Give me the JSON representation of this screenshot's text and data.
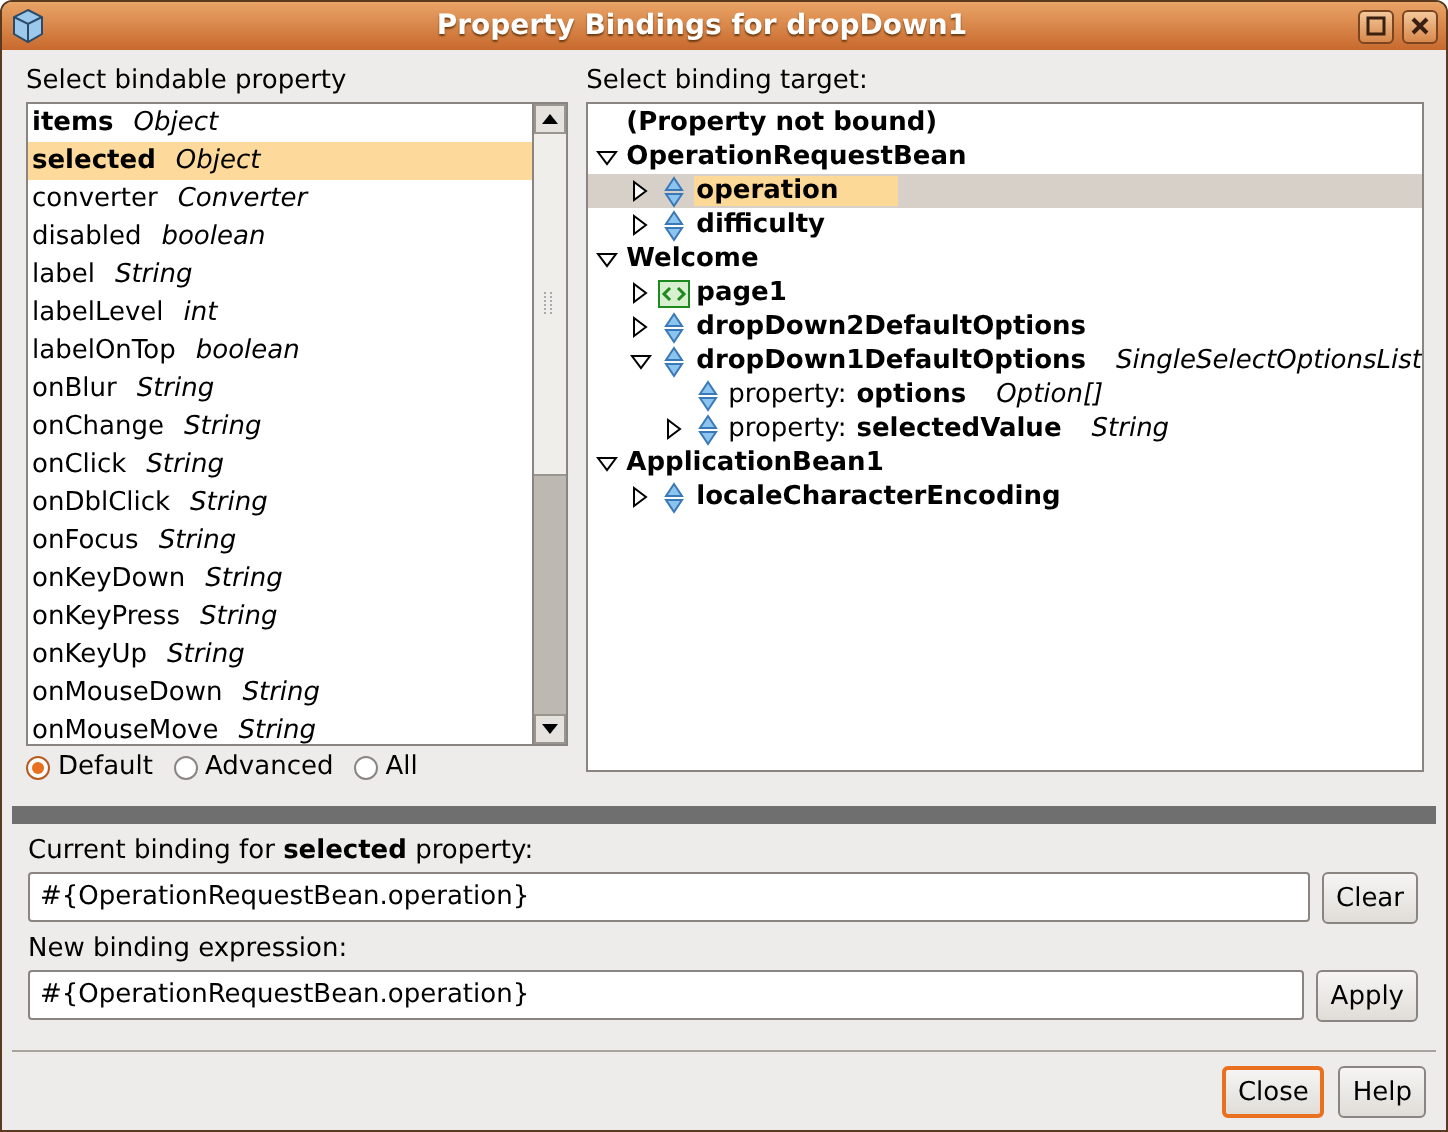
{
  "window": {
    "title": "Property Bindings for dropDown1"
  },
  "properties": {
    "label": "Select bindable property",
    "items": [
      {
        "name": "items",
        "type": "Object",
        "bold": true,
        "selected": false
      },
      {
        "name": "selected",
        "type": "Object",
        "bold": true,
        "selected": true
      },
      {
        "name": "converter",
        "type": "Converter",
        "bold": false,
        "selected": false
      },
      {
        "name": "disabled",
        "type": "boolean",
        "bold": false,
        "selected": false
      },
      {
        "name": "label",
        "type": "String",
        "bold": false,
        "selected": false
      },
      {
        "name": "labelLevel",
        "type": "int",
        "bold": false,
        "selected": false
      },
      {
        "name": "labelOnTop",
        "type": "boolean",
        "bold": false,
        "selected": false
      },
      {
        "name": "onBlur",
        "type": "String",
        "bold": false,
        "selected": false
      },
      {
        "name": "onChange",
        "type": "String",
        "bold": false,
        "selected": false
      },
      {
        "name": "onClick",
        "type": "String",
        "bold": false,
        "selected": false
      },
      {
        "name": "onDblClick",
        "type": "String",
        "bold": false,
        "selected": false
      },
      {
        "name": "onFocus",
        "type": "String",
        "bold": false,
        "selected": false
      },
      {
        "name": "onKeyDown",
        "type": "String",
        "bold": false,
        "selected": false
      },
      {
        "name": "onKeyPress",
        "type": "String",
        "bold": false,
        "selected": false
      },
      {
        "name": "onKeyUp",
        "type": "String",
        "bold": false,
        "selected": false
      },
      {
        "name": "onMouseDown",
        "type": "String",
        "bold": false,
        "selected": false
      },
      {
        "name": "onMouseMove",
        "type": "String",
        "bold": false,
        "selected": false
      }
    ],
    "filters": [
      {
        "label": "Default",
        "selected": true
      },
      {
        "label": "Advanced",
        "selected": false
      },
      {
        "label": "All",
        "selected": false
      }
    ]
  },
  "target": {
    "label": "Select binding target:",
    "tree": [
      {
        "name": "(Property not bound)",
        "selected": false
      },
      {
        "name": "OperationRequestBean",
        "expanded": true,
        "selected": false,
        "children": [
          {
            "name": "operation",
            "kind": "property",
            "expanded": false,
            "selected": true
          },
          {
            "name": "difficulty",
            "kind": "property",
            "expanded": false,
            "selected": false
          }
        ]
      },
      {
        "name": "Welcome",
        "expanded": true,
        "selected": false,
        "children": [
          {
            "name": "page1",
            "kind": "page",
            "expanded": false,
            "selected": false
          },
          {
            "name": "dropDown2DefaultOptions",
            "kind": "property",
            "expanded": false,
            "selected": false
          },
          {
            "name": "dropDown1DefaultOptions",
            "type": "SingleSelectOptionsList",
            "kind": "property",
            "expanded": true,
            "selected": false,
            "children": [
              {
                "prefix": "property:",
                "name": "options",
                "type": "Option[]",
                "kind": "property",
                "selected": false
              },
              {
                "prefix": "property:",
                "name": "selectedValue",
                "type": "String",
                "kind": "property",
                "expanded": false,
                "selected": false
              }
            ]
          }
        ]
      },
      {
        "name": "ApplicationBean1",
        "expanded": true,
        "selected": false,
        "children": [
          {
            "name": "localeCharacterEncoding",
            "kind": "property",
            "expanded": false,
            "selected": false
          }
        ]
      }
    ]
  },
  "current": {
    "label": "Current binding for **selected** property:",
    "value": "#{OperationRequestBean.operation}",
    "button": "Clear"
  },
  "new": {
    "label": "New binding expression:",
    "value": "#{OperationRequestBean.operation}",
    "button": "Apply"
  },
  "buttons": [
    {
      "label": "Close",
      "default": true
    },
    {
      "label": "Help",
      "default": false
    }
  ]
}
